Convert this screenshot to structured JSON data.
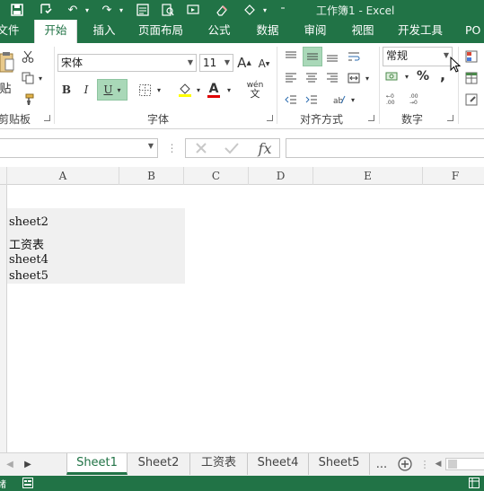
{
  "app": {
    "title": "工作簿1 - Excel"
  },
  "tabs": [
    "文件",
    "开始",
    "插入",
    "页面布局",
    "公式",
    "数据",
    "审阅",
    "视图",
    "开发工具",
    "PO"
  ],
  "ribbon": {
    "clipboard": {
      "paste_label": "贴",
      "group_label": "剪贴板"
    },
    "font": {
      "name": "宋体",
      "size": "11",
      "grow": "A",
      "shrink": "A",
      "bold": "B",
      "italic": "I",
      "underline": "U",
      "font_color": "A",
      "phonetic": "wén",
      "group_label": "字体"
    },
    "alignment": {
      "group_label": "对齐方式"
    },
    "number": {
      "format": "常规",
      "percent": "%",
      "comma": ",",
      "group_label": "数字"
    }
  },
  "formula_bar": {
    "fx": "fx",
    "name_value": "",
    "formula_value": ""
  },
  "columns": [
    "A",
    "B",
    "C",
    "D",
    "E",
    "F"
  ],
  "cells": [
    "sheet2",
    "工资表",
    "sheet4",
    "sheet5"
  ],
  "sheet_tabs": [
    "Sheet1",
    "Sheet2",
    "工资表",
    "Sheet4",
    "Sheet5"
  ],
  "sheet_more": "...",
  "active_sheet": "Sheet1",
  "colors": {
    "excel_green": "#217346",
    "selection_fill": "#f0f0f0"
  }
}
